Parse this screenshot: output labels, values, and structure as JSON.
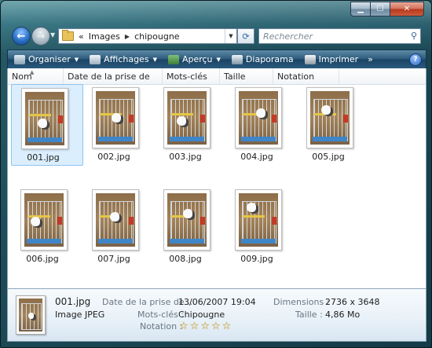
{
  "window": {
    "buttons": {
      "minimize": "",
      "maximize": "",
      "close": ""
    }
  },
  "nav": {
    "address": {
      "prefix": "«",
      "parts": [
        "Images",
        "chipougne"
      ]
    },
    "search_placeholder": "Rechercher"
  },
  "toolbar": {
    "organiser": "Organiser",
    "affichages": "Affichages",
    "apercu": "Aperçu",
    "diaporama": "Diaporama",
    "imprimer": "Imprimer",
    "more": "»",
    "help": "?"
  },
  "columns": [
    "Nom",
    "Date de la prise de vue",
    "Mots-clés",
    "Taille",
    "Notation"
  ],
  "files": [
    {
      "name": "001.jpg",
      "selected": true
    },
    {
      "name": "002.jpg",
      "selected": false
    },
    {
      "name": "003.jpg",
      "selected": false
    },
    {
      "name": "004.jpg",
      "selected": false
    },
    {
      "name": "005.jpg",
      "selected": false
    },
    {
      "name": "006.jpg",
      "selected": false
    },
    {
      "name": "007.jpg",
      "selected": false
    },
    {
      "name": "008.jpg",
      "selected": false
    },
    {
      "name": "009.jpg",
      "selected": false
    }
  ],
  "details": {
    "filename": "001.jpg",
    "filetype": "Image JPEG",
    "date_label": "Date de la prise de ...",
    "date_value": "13/06/2007 19:04",
    "keywords_label": "Mots-clés :",
    "keywords_value": "Chipougne",
    "rating_label": "Notation :",
    "rating_value": 0,
    "rating_max": 5,
    "dimensions_label": "Dimensions :",
    "dimensions_value": "2736 x 3648",
    "size_label": "Taille :",
    "size_value": "4,86 Mo"
  }
}
